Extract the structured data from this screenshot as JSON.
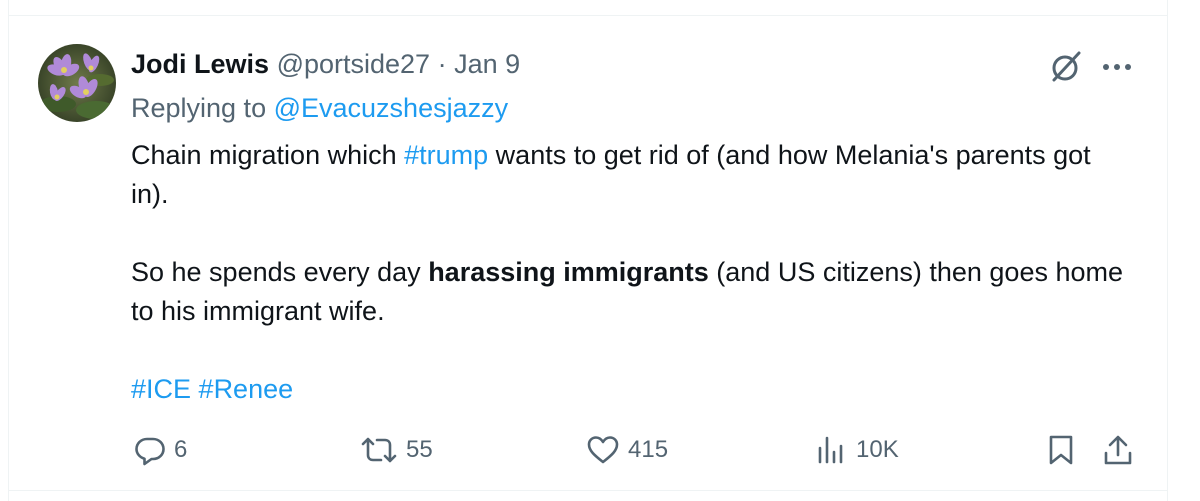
{
  "tweet": {
    "author_name": "Jodi Lewis",
    "handle": "@portside27",
    "separator": "·",
    "date": "Jan 9",
    "replying_to_prefix": "Replying to",
    "replying_to_handle": "@Evacuzshesjazzy",
    "body": {
      "line1_before": "Chain migration which ",
      "line1_hashtag": "#trump",
      "line1_after": " wants to get rid of (and how Melania's parents got in).",
      "line2_before": "So he spends every day ",
      "line2_bold": "harassing immigrants",
      "line2_after": " (and US citizens) then goes home to his immigrant wife.",
      "hashtag_ice": "#ICE",
      "hashtag_renee": "#Renee"
    }
  },
  "actions": {
    "replies": "6",
    "reposts": "55",
    "likes": "415",
    "views": "10K"
  },
  "colors": {
    "text": "#0f1419",
    "secondary": "#536471",
    "link": "#1d9bf0",
    "divider": "#eff3f4"
  },
  "icons": [
    "grok-icon",
    "more-icon",
    "reply-icon",
    "repost-icon",
    "like-icon",
    "views-icon",
    "bookmark-icon",
    "share-icon"
  ]
}
